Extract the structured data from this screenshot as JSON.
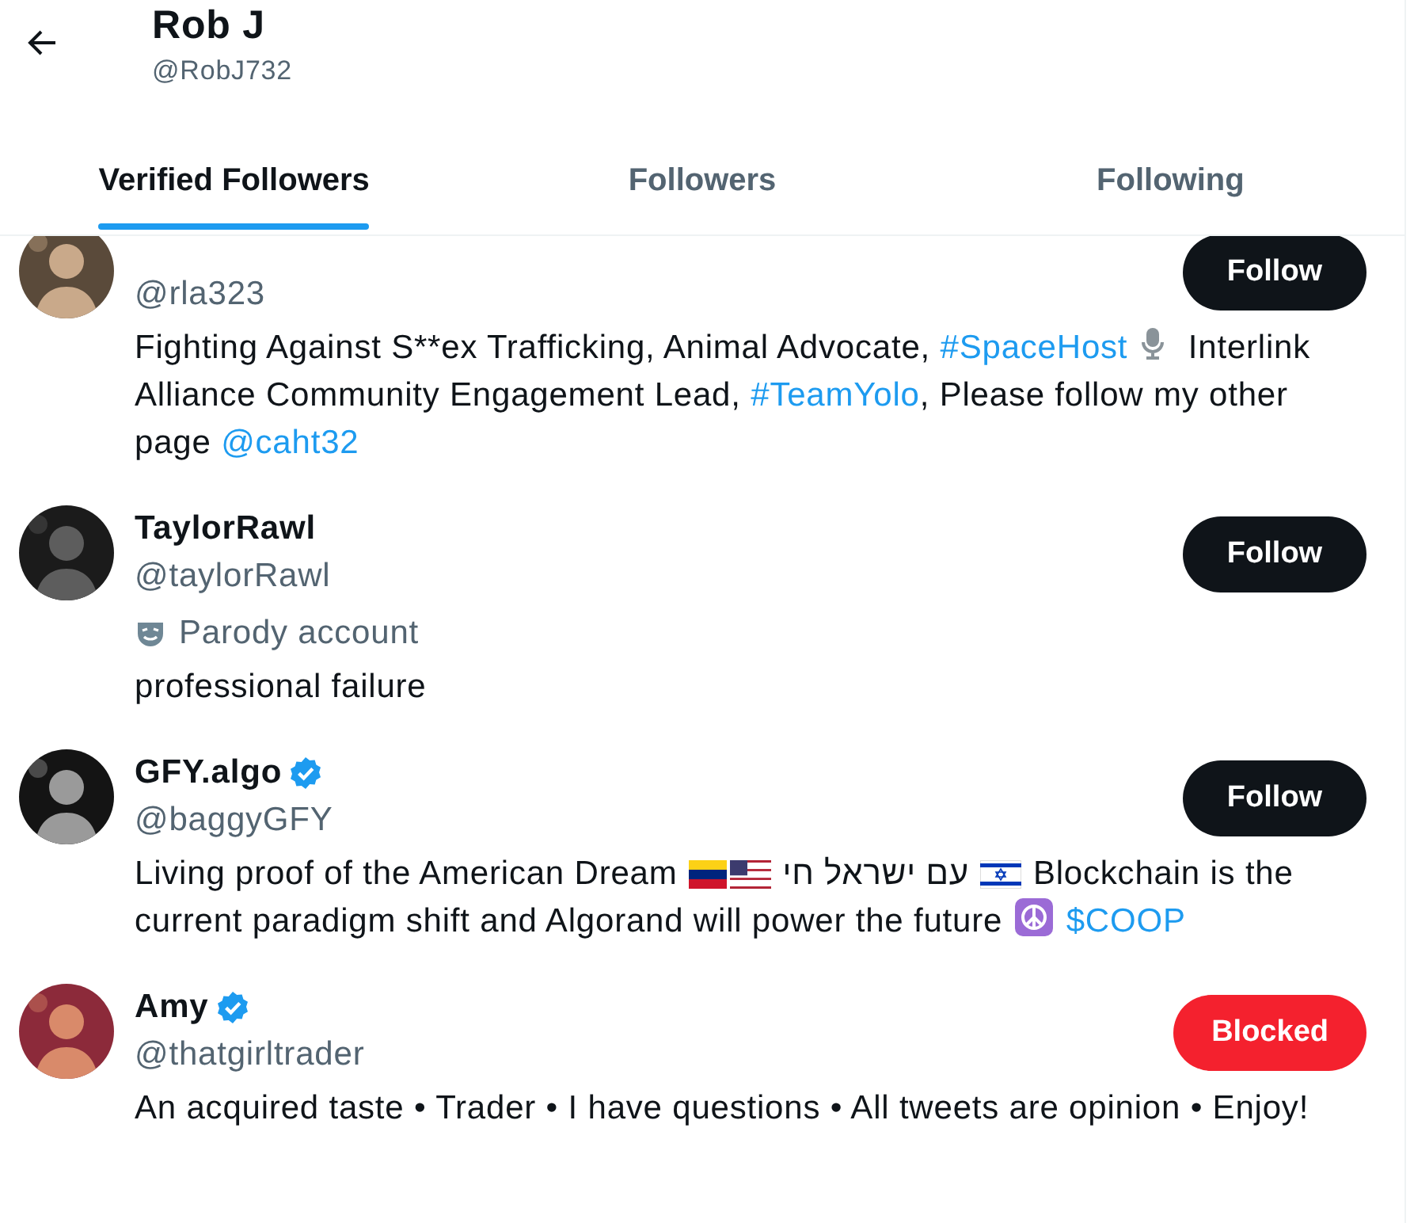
{
  "profile": {
    "name": "Rob J",
    "handle": "@RobJ732"
  },
  "tabs": [
    {
      "label": "Verified Followers",
      "selected": true
    },
    {
      "label": "Followers",
      "selected": false
    },
    {
      "label": "Following",
      "selected": false
    }
  ],
  "users": [
    {
      "handle": "@rla323",
      "button": {
        "label": "Follow",
        "kind": "follow"
      },
      "bio": [
        {
          "kind": "text",
          "text": "Fighting Against S**ex Trafficking, Animal Advocate, "
        },
        {
          "kind": "link",
          "text": "#SpaceHost"
        },
        {
          "kind": "microphone"
        },
        {
          "kind": "text",
          "text": " Interlink Alliance Community Engagement Lead, "
        },
        {
          "kind": "link",
          "text": "#TeamYolo"
        },
        {
          "kind": "text",
          "text": ", Please follow my other page "
        },
        {
          "kind": "link",
          "text": "@caht32"
        }
      ]
    },
    {
      "name": "TaylorRawl",
      "handle": "@taylorRawl",
      "verified": false,
      "label": "Parody account",
      "button": {
        "label": "Follow",
        "kind": "follow"
      },
      "bio": [
        {
          "kind": "text",
          "text": "professional failure"
        }
      ]
    },
    {
      "name": "GFY.algo",
      "handle": "@baggyGFY",
      "verified": true,
      "button": {
        "label": "Follow",
        "kind": "follow"
      },
      "bio": [
        {
          "kind": "text",
          "text": "Living proof of the American Dream "
        },
        {
          "kind": "flag"
        },
        {
          "kind": "flag"
        },
        {
          "kind": "text",
          "text": " עם ישראל חי "
        },
        {
          "kind": "flag"
        },
        {
          "kind": "text",
          "text": " Blockchain is the current paradigm shift and Algorand will power the future "
        },
        {
          "kind": "peace"
        },
        {
          "kind": "link",
          "text": "$COOP"
        }
      ]
    },
    {
      "name": "Amy",
      "handle": "@thatgirltrader",
      "verified": true,
      "button": {
        "label": "Blocked",
        "kind": "blocked"
      },
      "bio": [
        {
          "kind": "text",
          "text": "An acquired taste • Trader • I have questions • All tweets are opinion • Enjoy!"
        }
      ]
    }
  ]
}
